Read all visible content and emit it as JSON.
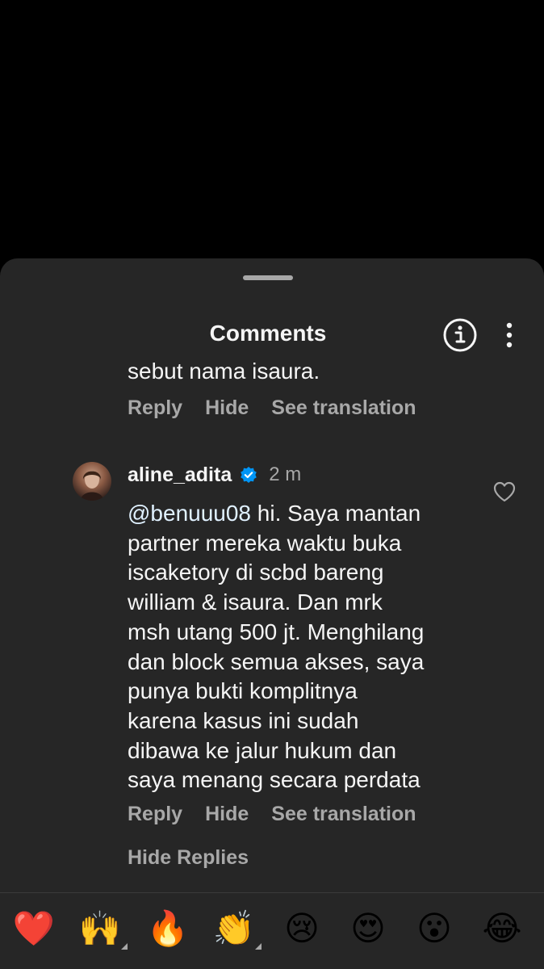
{
  "sheet": {
    "title": "Comments"
  },
  "previous_comment": {
    "text_tail": "sebut nama isaura.",
    "actions": [
      "Reply",
      "Hide",
      "See translation"
    ]
  },
  "comment": {
    "username": "aline_adita",
    "verified": true,
    "time": "2 m",
    "mention": "@benuuu08",
    "text": " hi. Saya mantan\npartner mereka waktu buka\niscaketory di scbd bareng\nwilliam & isaura. Dan mrk\nmsh utang 500 jt. Menghilang\ndan block semua akses, saya\npunya bukti komplitnya\nkarena kasus ini sudah\ndibawa ke jalur hukum dan\nsaya menang secara perdata",
    "actions": [
      "Reply",
      "Hide",
      "See translation"
    ]
  },
  "hide_replies": "Hide Replies",
  "emoji_bar": [
    "❤️",
    "🙌",
    "🔥",
    "👏",
    "😢",
    "😍",
    "😮",
    "😂"
  ],
  "colors": {
    "background": "#000000",
    "sheet": "#262626",
    "primary_text": "#f5f5f5",
    "secondary_text": "#a8a8a8",
    "verified_badge": "#0095f6"
  }
}
